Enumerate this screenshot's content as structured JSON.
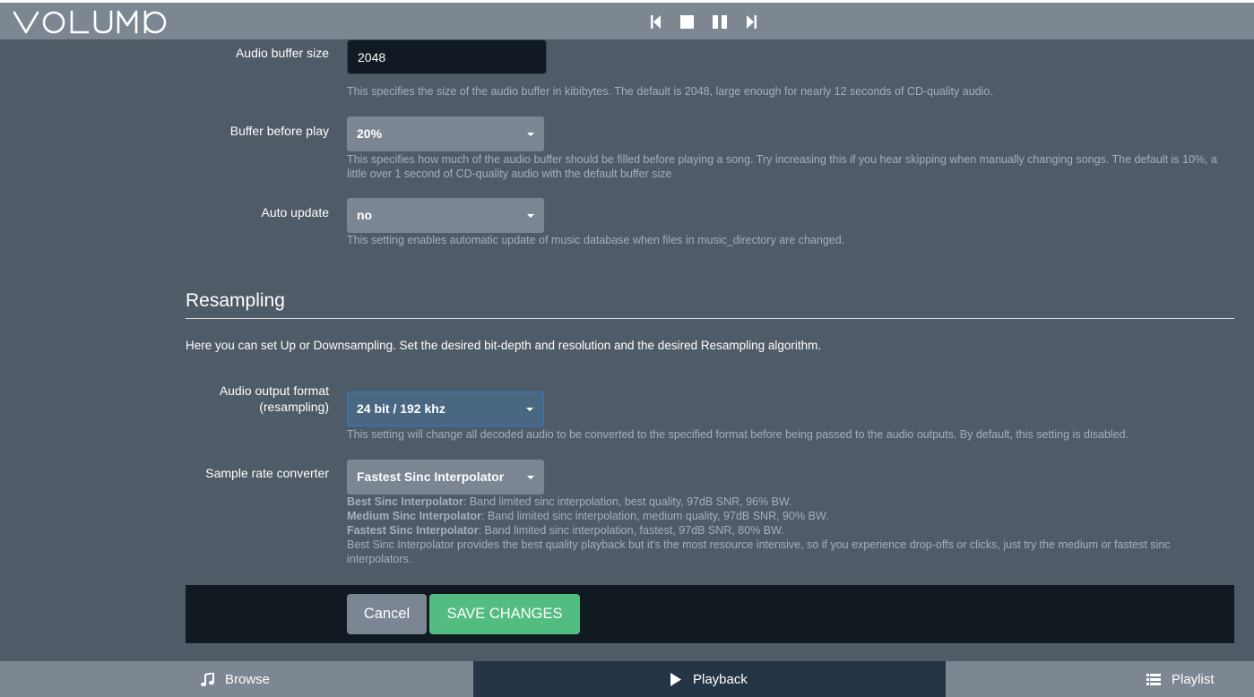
{
  "app": {
    "name": "VOLUMIO",
    "accent": "#53bd81",
    "header_bg": "#7c8792"
  },
  "header": {
    "transport": [
      {
        "name": "previous-icon"
      },
      {
        "name": "stop-icon"
      },
      {
        "name": "pause-icon"
      },
      {
        "name": "next-icon"
      }
    ]
  },
  "settings": {
    "audio_buffer": {
      "label": "Audio buffer size",
      "value": "2048",
      "help": "This specifies the size of the audio buffer in kibibytes. The default is 2048, large enough for nearly 12 seconds of CD-quality audio."
    },
    "buffer_before_play": {
      "label": "Buffer before play",
      "value": "20%",
      "help": "This specifies how much of the audio buffer should be filled before playing a song. Try increasing this if you hear skipping when manually changing songs. The default is 10%, a little over 1 second of CD-quality audio with the default buffer size"
    },
    "auto_update": {
      "label": "Auto update",
      "value": "no",
      "help": "This setting enables automatic update of music database when files in music_directory are changed."
    }
  },
  "resampling": {
    "title": "Resampling",
    "description": "Here you can set Up or Downsampling. Set the desired bit-depth and resolution and the desired Resampling algorithm.",
    "output_format": {
      "label_line1": "Audio output format",
      "label_line2": "(resampling)",
      "value": "24 bit / 192 khz",
      "help": "This setting will change all decoded audio to be converted to the specified format before being passed to the audio outputs. By default, this setting is disabled."
    },
    "sample_rate_converter": {
      "label": "Sample rate converter",
      "value": "Fastest Sinc Interpolator",
      "help": {
        "best_name": "Best Sinc Interpolator",
        "best_desc": ": Band limited sinc interpolation, best quality, 97dB SNR, 96% BW.",
        "medium_name": "Medium Sinc Interpolator",
        "medium_desc": ": Band limited sinc interpolation, medium quality, 97dB SNR, 90% BW.",
        "fastest_name": "Fastest Sinc Interpolator",
        "fastest_desc": ": Band limited sinc interpolation, fastest, 97dB SNR, 80% BW.",
        "note": "Best Sinc Interpolator provides the best quality playback but it's the most resource intensive, so if you experience drop-offs or clicks, just try the medium or fastest sinc interpolators."
      }
    }
  },
  "actions": {
    "cancel_label": "Cancel",
    "save_label": "SAVE CHANGES"
  },
  "bottom_nav": {
    "browse_label": "Browse",
    "playback_label": "Playback",
    "playlist_label": "Playlist",
    "active": "Playback"
  }
}
